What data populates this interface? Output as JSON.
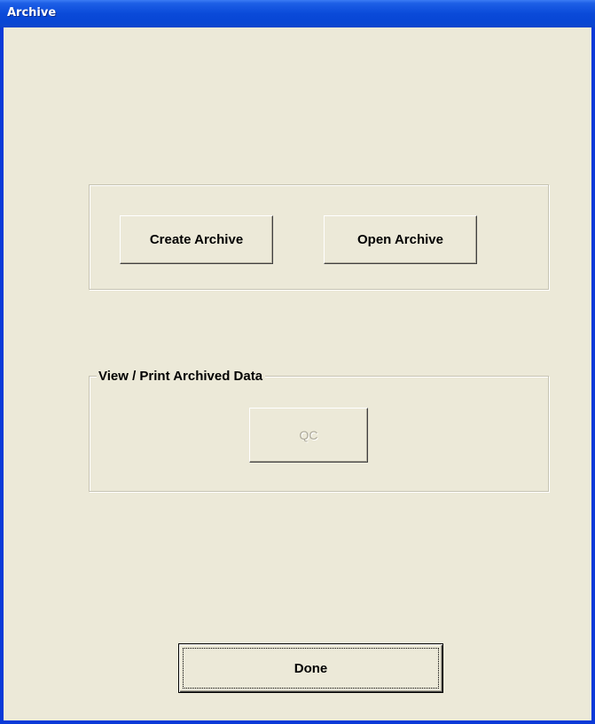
{
  "window": {
    "title": "Archive"
  },
  "archive_group": {
    "create_label": "Create Archive",
    "open_label": "Open Archive"
  },
  "view_print_group": {
    "legend": "View / Print Archived Data",
    "qc_label": "QC",
    "qc_enabled": false
  },
  "footer": {
    "done_label": "Done"
  },
  "colors": {
    "titlebar": "#0a4ad9",
    "face": "#ece9d8",
    "disabled_text": "#aca899"
  }
}
